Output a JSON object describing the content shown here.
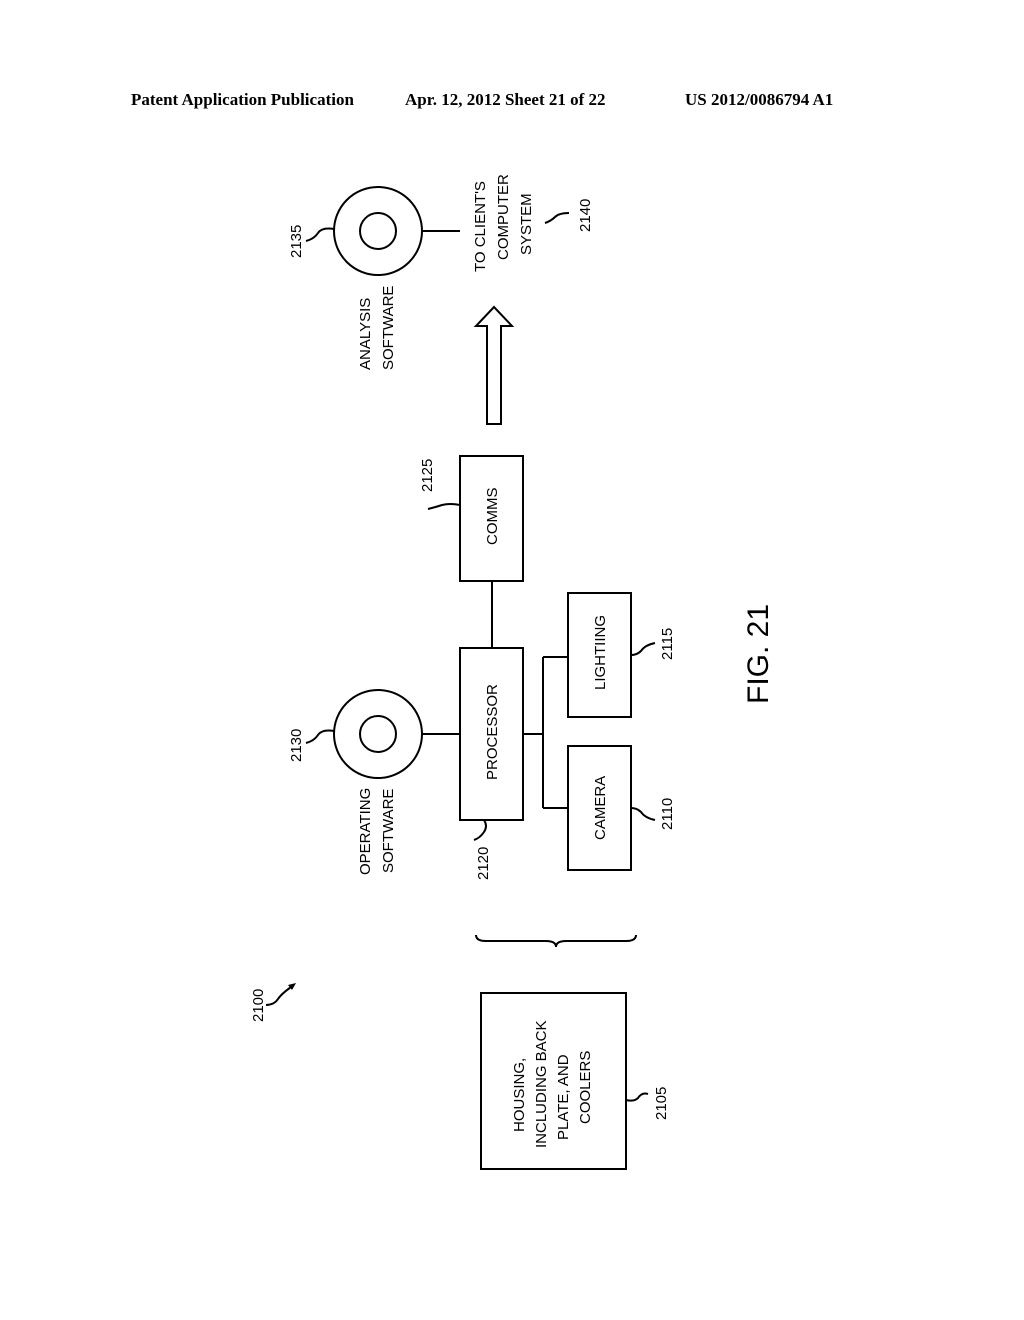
{
  "header": {
    "publication": "Patent Application Publication",
    "date_sheet": "Apr. 12, 2012  Sheet 21 of 22",
    "patent_number": "US 2012/0086794 A1"
  },
  "figure": {
    "label": "FIG. 21",
    "system_ref": "2100",
    "blocks": {
      "housing": {
        "ref": "2105",
        "lines": [
          "HOUSING,",
          "INCLUDING BACK",
          "PLATE, AND",
          "COOLERS"
        ]
      },
      "camera": {
        "ref": "2110",
        "label": "CAMERA"
      },
      "lighting": {
        "ref": "2115",
        "label": "LIGHTIING"
      },
      "processor": {
        "ref": "2120",
        "label": "PROCESSOR"
      },
      "comms": {
        "ref": "2125",
        "label": "COMMS"
      }
    },
    "discs": {
      "operating_software": {
        "ref": "2130",
        "lines": [
          "OPERATING",
          "SOFTWARE"
        ]
      },
      "analysis_software": {
        "ref": "2135",
        "lines": [
          "ANALYSIS",
          "SOFTWARE"
        ]
      }
    },
    "client": {
      "ref": "2140",
      "lines": [
        "TO CLIENT'S",
        "COMPUTER",
        "SYSTEM"
      ]
    }
  }
}
